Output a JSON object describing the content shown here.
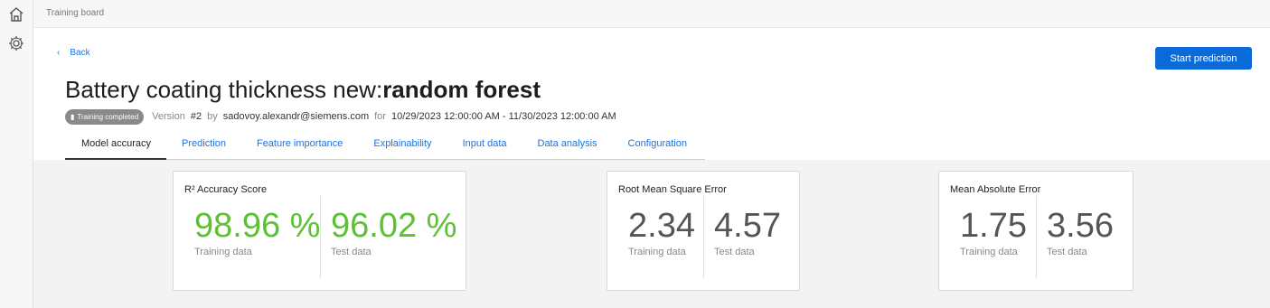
{
  "topbar": {
    "breadcrumb": "Training board"
  },
  "sidebar": {
    "icons": [
      "home-icon",
      "settings-gear-icon"
    ]
  },
  "back": {
    "label": "Back"
  },
  "actions": {
    "start_prediction": "Start prediction"
  },
  "title": {
    "prefix": "Battery coating thickness new:",
    "model": "random forest"
  },
  "meta": {
    "badge": "Training completed",
    "version_prefix": "Version",
    "version": "#2",
    "by": "by",
    "author": "sadovoy.alexandr@siemens.com",
    "for": "for",
    "range": "10/29/2023 12:00:00 AM - 11/30/2023 12:00:00 AM"
  },
  "tabs": [
    {
      "label": "Model accuracy",
      "active": true
    },
    {
      "label": "Prediction",
      "active": false
    },
    {
      "label": "Feature importance",
      "active": false
    },
    {
      "label": "Explainability",
      "active": false
    },
    {
      "label": "Input data",
      "active": false
    },
    {
      "label": "Data analysis",
      "active": false
    },
    {
      "label": "Configuration",
      "active": false
    }
  ],
  "cards": [
    {
      "title": "R² Accuracy Score",
      "training_value": "98.96 %",
      "test_value": "96.02 %",
      "training_label": "Training data",
      "test_label": "Test data",
      "color": "#5cc234"
    },
    {
      "title": "Root Mean Square Error",
      "training_value": "2.34",
      "test_value": "4.57",
      "training_label": "Training data",
      "test_label": "Test data",
      "color": "#555555"
    },
    {
      "title": "Mean Absolute Error",
      "training_value": "1.75",
      "test_value": "3.56",
      "training_label": "Training data",
      "test_label": "Test data",
      "color": "#555555"
    }
  ]
}
